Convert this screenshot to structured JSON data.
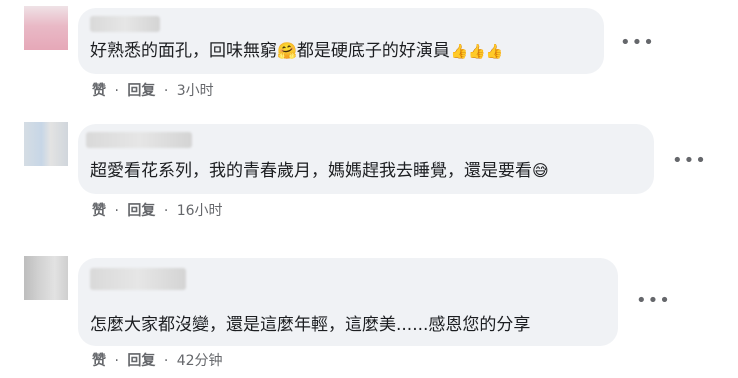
{
  "comments": [
    {
      "text": "好熟悉的面孔，回味無窮😊都是硬底子的好演員👍👍👍",
      "text_main": "好熟悉的面孔，回味無窮",
      "emoji1": "🤗",
      "text_tail": "都是硬底子的好演員",
      "trailing_emoji": "👍👍👍",
      "like_label": "赞",
      "reply_label": "回复",
      "time": "3小时"
    },
    {
      "text_main": "超愛看花系列，我的青春歲月，媽媽趕我去睡覺，還是要看",
      "trailing_emoji": "😅",
      "like_label": "赞",
      "reply_label": "回复",
      "time": "16小时"
    },
    {
      "text_main": "怎麼大家都沒變，還是這麼年輕，這麼美......感恩您的分享",
      "like_label": "赞",
      "reply_label": "回复",
      "time": "42分钟"
    }
  ],
  "more_icon": "more-horizontal-icon",
  "more_glyph": "•••",
  "separator": "·"
}
